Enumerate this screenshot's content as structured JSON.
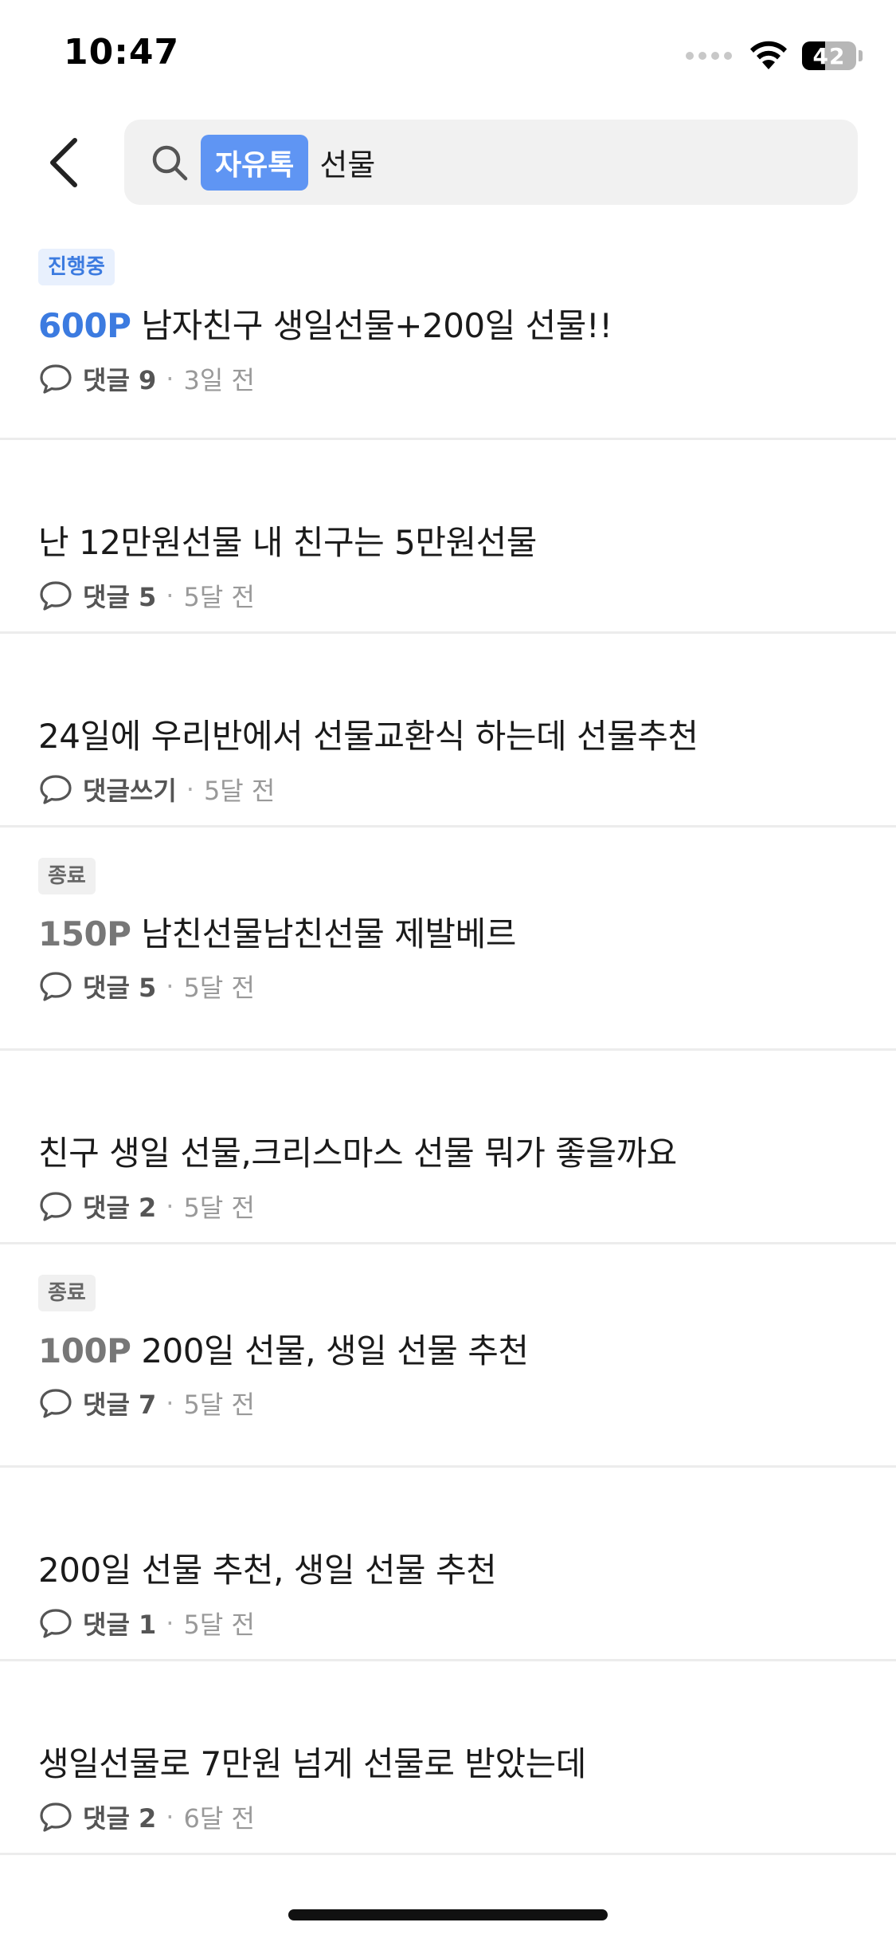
{
  "status_bar": {
    "time": "10:47",
    "battery": "42",
    "battery_level": 0.42
  },
  "search": {
    "board_chip": "자유톡",
    "query": "선물"
  },
  "posts": [
    {
      "badge": "진행중",
      "badge_type": "ongoing",
      "points": "600P",
      "title": "남자친구 생일선물+200일 선물!!",
      "comments": "댓글 9",
      "time": "3일 전"
    },
    {
      "badge": "",
      "points": "",
      "title": "난 12만원선물 내 친구는 5만원선물",
      "comments": "댓글 5",
      "time": "5달 전"
    },
    {
      "badge": "",
      "points": "",
      "title": "24일에 우리반에서 선물교환식 하는데 선물추천",
      "comments": "댓글쓰기",
      "time": "5달 전"
    },
    {
      "badge": "종료",
      "badge_type": "ended",
      "points": "150P",
      "title": "남친선물남친선물 제발베르",
      "comments": "댓글 5",
      "time": "5달 전"
    },
    {
      "badge": "",
      "points": "",
      "title": "친구 생일 선물,크리스마스 선물 뭐가 좋을까요",
      "comments": "댓글 2",
      "time": "5달 전"
    },
    {
      "badge": "종료",
      "badge_type": "ended",
      "points": "100P",
      "title": "200일 선물, 생일 선물 추천",
      "comments": "댓글 7",
      "time": "5달 전"
    },
    {
      "badge": "",
      "points": "",
      "title": "200일 선물 추천, 생일 선물 추천",
      "comments": "댓글 1",
      "time": "5달 전"
    },
    {
      "badge": "",
      "points": "",
      "title": "생일선물로 7만원 넘게 선물로 받았는데",
      "comments": "댓글 2",
      "time": "6달 전"
    }
  ],
  "colors": {
    "accent": "#5f95f3",
    "points_active": "#3c7be0",
    "points_ended": "#777777",
    "divider": "#ececec"
  }
}
